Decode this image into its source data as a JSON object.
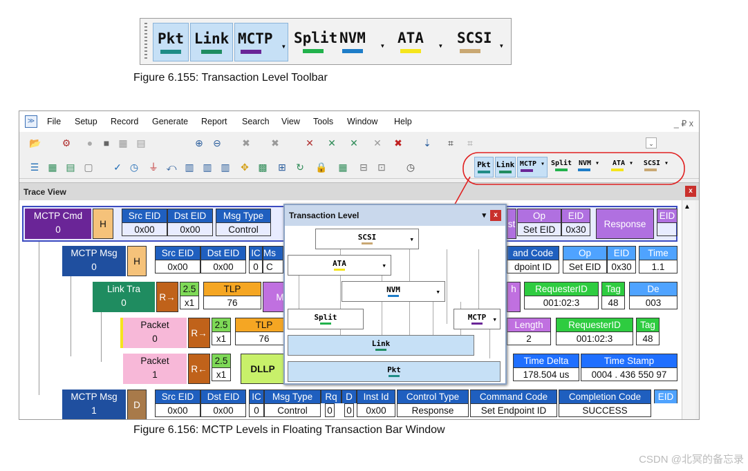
{
  "toolbar_figure": {
    "buttons": [
      {
        "label": "Pkt",
        "color": "#1f8c86",
        "selected": true,
        "dropdown": false
      },
      {
        "label": "Link",
        "color": "#1f8c60",
        "selected": true,
        "dropdown": false
      },
      {
        "label": "MCTP",
        "color": "#6a2597",
        "selected": true,
        "dropdown": true
      },
      {
        "label": "Split",
        "color": "#22b24c",
        "selected": false,
        "dropdown": false
      },
      {
        "label": "NVM",
        "color": "#1e7dc8",
        "selected": false,
        "dropdown": true
      },
      {
        "label": "ATA",
        "color": "#f5e51c",
        "selected": false,
        "dropdown": true
      },
      {
        "label": "SCSI",
        "color": "#c9a873",
        "selected": false,
        "dropdown": true
      }
    ],
    "dropdown_glyph": "▾",
    "caption": "Figure 6.155:  Transaction Level Toolbar"
  },
  "app": {
    "menu": [
      "File",
      "Setup",
      "Record",
      "Generate",
      "Report",
      "Search",
      "View",
      "Tools",
      "Window",
      "Help"
    ],
    "window_controls": "_ ₽ x",
    "trace_view_title": "Trace View",
    "close_glyph": "x"
  },
  "trace": {
    "r1": {
      "name": "MCTP Cmd",
      "idx": "0",
      "flag": "H",
      "src_h": "Src EID",
      "src_v": "0x00",
      "dst_h": "Dst EID",
      "dst_v": "0x00",
      "mt_h": "Msg Type",
      "mt_v": "Control",
      "op_h": "Op",
      "op_v": "Set EID",
      "eid_h": "EID",
      "eid_v": "0x30",
      "resp": "Response",
      "eid2": "EID",
      "st": "st"
    },
    "r2": {
      "name": "MCTP Msg",
      "idx": "0",
      "flag": "H",
      "src_h": "Src EID",
      "src_v": "0x00",
      "dst_h": "Dst EID",
      "dst_v": "0x00",
      "ic_h": "IC",
      "ic_v": "0",
      "ms_h": "Ms",
      "ms_v": "C",
      "cc_h": "and Code",
      "cc_v": "dpoint ID",
      "op_h": "Op",
      "op_v": "Set EID",
      "eid_h": "EID",
      "eid_v": "0x30",
      "tm_h": "Time",
      "tm_v": "1.1"
    },
    "r3": {
      "name": "Link Tra",
      "idx": "0",
      "dir": "R→",
      "sp": "2.5",
      "w": "x1",
      "tlp_h": "TLP",
      "tlp_v": "76",
      "m": "M",
      "h": "h",
      "req_h": "RequesterID",
      "req_v": "001:02:3",
      "tag_h": "Tag",
      "tag_v": "48",
      "dev_h": "De",
      "dev_v": "003"
    },
    "r4": {
      "name": "Packet",
      "idx": "0",
      "dir": "R→",
      "sp": "2.5",
      "w": "x1",
      "tlp_h": "TLP",
      "tlp_v": "76",
      "len_h": "Length",
      "len_v": "2",
      "req_h": "RequesterID",
      "req_v": "001:02:3",
      "tag_h": "Tag",
      "tag_v": "48"
    },
    "r5": {
      "name": "Packet",
      "idx": "1",
      "dir": "R←",
      "sp": "2.5",
      "w": "x1",
      "dllp": "DLLP",
      "td_h": "Time Delta",
      "td_v": "178.504 us",
      "ts_h": "Time Stamp",
      "ts_v": "0004 . 436 550 97"
    },
    "r6": {
      "name": "MCTP Msg",
      "idx": "1",
      "flag": "D",
      "src_h": "Src EID",
      "src_v": "0x00",
      "dst_h": "Dst EID",
      "dst_v": "0x00",
      "ic_h": "IC",
      "ic_v": "0",
      "mt_h": "Msg Type",
      "mt_v": "Control",
      "rq_h": "Rq",
      "rq_v": "0",
      "d_h": "D",
      "d_v": "0",
      "ii_h": "Inst Id",
      "ii_v": "0x00",
      "ct_h": "Control Type",
      "ct_v": "Response",
      "cc_h": "Command Code",
      "cc_v": "Set Endpoint ID",
      "comp_h": "Completion Code",
      "comp_v": "SUCCESS",
      "eid_h": "EID"
    }
  },
  "floating": {
    "title": "Transaction Level",
    "scsi": "SCSI",
    "ata": "ATA",
    "nvm": "NVM",
    "split": "Split",
    "mctp": "MCTP",
    "link": "Link",
    "pkt": "Pkt",
    "caret": "▾"
  },
  "caption2": "Figure 6.156:  MCTP Levels in Floating Transaction Bar Window",
  "watermark": "CSDN @北冥的备忘录"
}
